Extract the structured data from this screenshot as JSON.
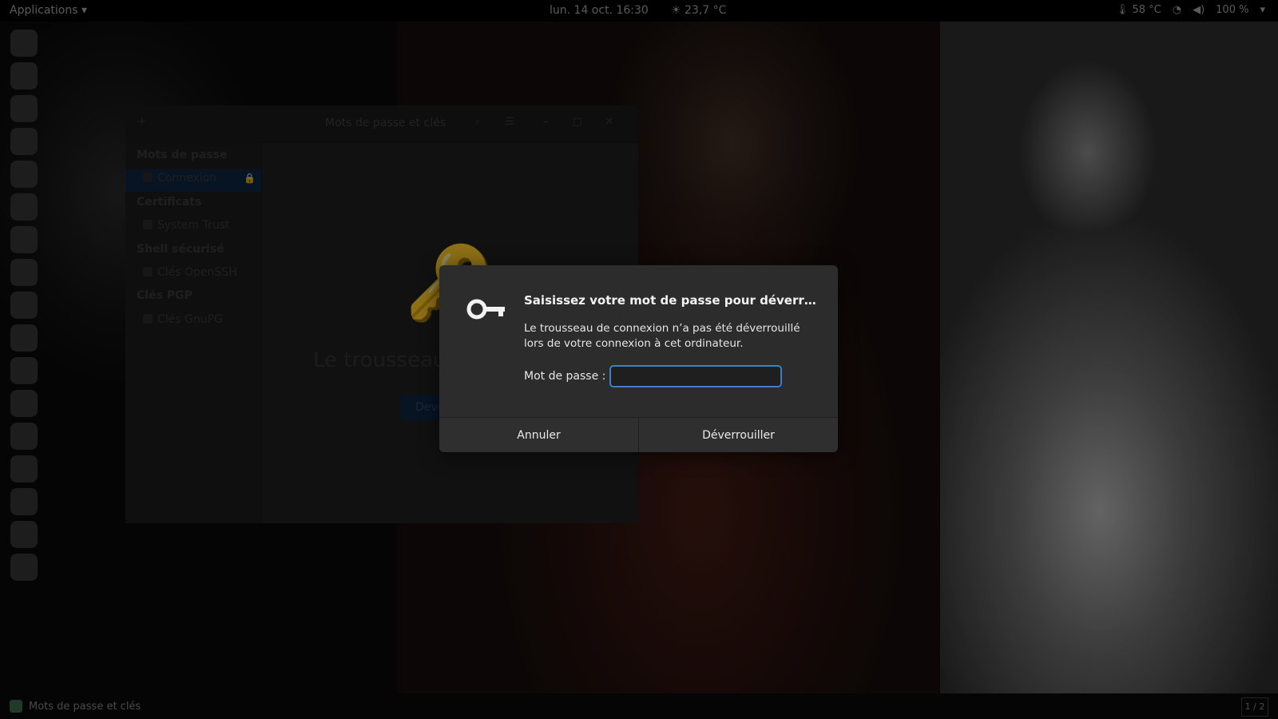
{
  "topbar": {
    "applications_label": "Applications ▾",
    "clock": "lun. 14 oct.  16:30",
    "weather": "☀ 23,7 °C",
    "cpu_temp": "🌡 58 °C",
    "battery": "100 %"
  },
  "app_window": {
    "title": "Mots de passe et clés",
    "sidebar": {
      "sections": [
        {
          "label": "Mots de passe",
          "items": [
            "Connexion"
          ]
        },
        {
          "label": "Certificats",
          "items": [
            "System Trust"
          ]
        },
        {
          "label": "Shell sécurisé",
          "items": [
            "Clés OpenSSH"
          ]
        },
        {
          "label": "Clés PGP",
          "items": [
            "Clés GnuPG"
          ]
        }
      ]
    },
    "locked_text": "Le trousseau",
    "unlock_button_label": "Deve"
  },
  "dialog": {
    "heading": "Saisissez votre mot de passe pour déverrouiller l...",
    "description": "Le trousseau de connexion n’a pas été déverrouillé lors de votre connexion à cet ordinateur.",
    "password_label": "Mot de passe :",
    "password_value": "",
    "cancel_label": "Annuler",
    "unlock_label": "Déverrouiller",
    "accent_color": "#3d7ec9"
  },
  "bottombar": {
    "task_label": "Mots de passe et clés",
    "workspace": "1 / 2"
  }
}
